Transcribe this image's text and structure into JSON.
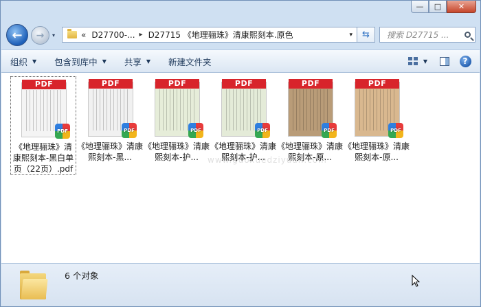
{
  "window": {
    "caption_buttons": {
      "minimize": "—",
      "maximize": "□",
      "close": "✕"
    }
  },
  "nav": {
    "back_glyph": "←",
    "forward_glyph": "→",
    "recent_glyph": "▾",
    "breadcrumb_overflow": "«",
    "crumbs": [
      "D27700-...",
      "D27715 《地理骊珠》清康熙刻本.原色"
    ],
    "crumb_separator": "▸",
    "address_dropdown": "▾",
    "refresh_glyph": "⇆",
    "search_placeholder": "搜索 D27715 ..."
  },
  "toolbar": {
    "organize": "组织",
    "include_in_library": "包含到库中",
    "share": "共享",
    "new_folder": "新建文件夹",
    "dropdown_glyph": "▼",
    "help_glyph": "?"
  },
  "files": [
    {
      "label": "《地理骊珠》清康熙刻本-黑白单页（22页）.pdf",
      "banner": "PDF",
      "badge": "PDF",
      "tone": "#f4f4f4",
      "selected": true
    },
    {
      "label": "《地理骊珠》清康熙刻本-黑...",
      "banner": "PDF",
      "badge": "PDF",
      "tone": "#f1f1f1",
      "selected": false
    },
    {
      "label": "《地理骊珠》清康熙刻本-护...",
      "banner": "PDF",
      "badge": "PDF",
      "tone": "#e6edd9",
      "selected": false
    },
    {
      "label": "《地理骊珠》清康熙刻本-护...",
      "banner": "PDF",
      "badge": "PDF",
      "tone": "#e4ebd8",
      "selected": false
    },
    {
      "label": "《地理骊珠》清康熙刻本-原...",
      "banner": "PDF",
      "badge": "PDF",
      "tone": "#b99c78",
      "selected": false
    },
    {
      "label": "《地理骊珠》清康熙刻本-原...",
      "banner": "PDF",
      "badge": "PDF",
      "tone": "#d9b88f",
      "selected": false
    }
  ],
  "status": {
    "count_text": "6 个对象"
  },
  "watermark": "www.guoxuedziyuan.com"
}
